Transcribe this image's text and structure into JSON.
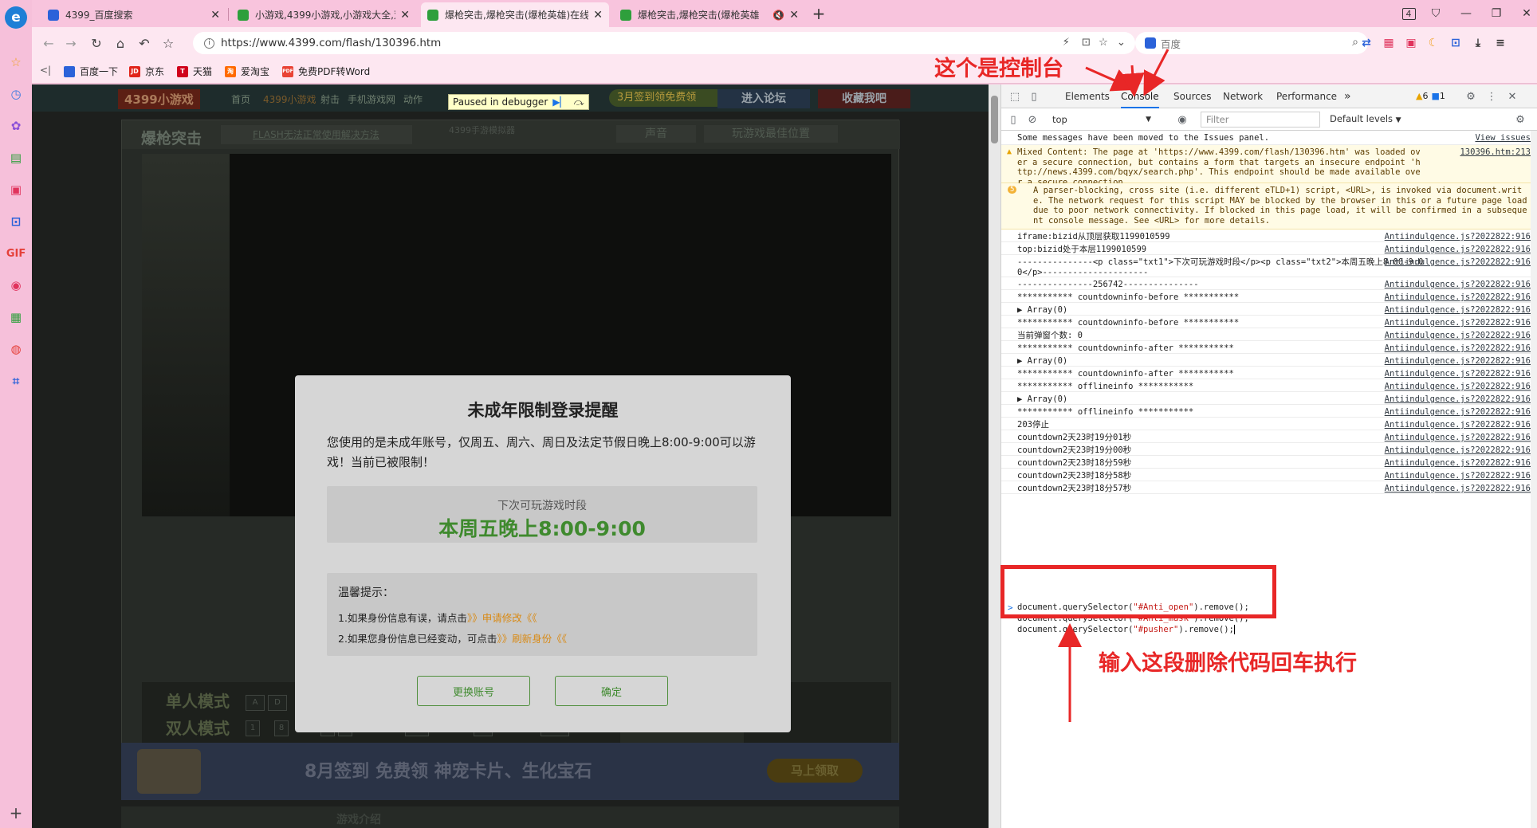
{
  "sidebar": {
    "icons": [
      "browser-logo-icon",
      "star-icon",
      "clock-icon",
      "puzzle-icon",
      "notes-icon",
      "pdf-icon",
      "crop-icon",
      "gif-icon",
      "record-icon",
      "qr-icon",
      "weibo-icon",
      "scan-icon",
      "add-icon"
    ],
    "gif_label": "GIF",
    "add_label": "+"
  },
  "tabs": [
    {
      "title": "4399_百度搜索",
      "favicon_color": "#2b62d9"
    },
    {
      "title": "小游戏,4399小游戏,小游戏大全,双",
      "favicon_color": "#2e9f3c"
    },
    {
      "title": "爆枪突击,爆枪突击(爆枪英雄)在线",
      "favicon_color": "#2e9f3c",
      "active": true
    },
    {
      "title": "爆枪突击,爆枪突击(爆枪英雄",
      "favicon_color": "#2e9f3c",
      "muted": true
    }
  ],
  "tab_new": "+",
  "tab_close": "✕",
  "window": {
    "tab_count": "4"
  },
  "address": {
    "url": "https://www.4399.com/flash/130396.htm",
    "search_placeholder": "百度"
  },
  "bookmarks": [
    {
      "label": "百度一下",
      "color": "#2b62d9",
      "glyph": "🐾"
    },
    {
      "label": "京东",
      "color": "#e1251b",
      "glyph": "JD"
    },
    {
      "label": "天猫",
      "color": "#d0021b",
      "glyph": "T"
    },
    {
      "label": "爱淘宝",
      "color": "#ff6a00",
      "glyph": "淘"
    },
    {
      "label": "免费PDF转Word",
      "color": "#e94335",
      "glyph": "PDF"
    }
  ],
  "page": {
    "logo": "4399小游戏",
    "nav": [
      "首页",
      "4399小游戏",
      "射击",
      "手机游戏网",
      "动作"
    ],
    "debugger_tip": "Paused in debugger",
    "checkin": "3月签到领免费领",
    "forum_btn": "进入论坛",
    "fav_btn": "收藏我吧",
    "game_title": "爆枪突击",
    "flash_tip": "FLASH无法正常使用解决方法",
    "promo_small": "4399手游模拟器",
    "sound": "声音",
    "best_pos": "玩游戏最佳位置",
    "mode_single": "单人模式",
    "mode_double": "双人模式",
    "banner_text": "8月签到 免费领 神宠卡片、生化宝石",
    "banner_btn": "马上领取",
    "intro": "游戏介绍"
  },
  "modal": {
    "title": "未成年限制登录提醒",
    "body": "您使用的是未成年账号，仅周五、周六、周日及法定节假日晚上8:00-9:00可以游戏！当前已被限制！",
    "next_label": "下次可玩游戏时段",
    "next_time": "本周五晚上8:00-9:00",
    "tips_title": "温馨提示：",
    "tip1_prefix": "1.如果身份信息有误，请点击",
    "tip1_link": "》》申请修改《《",
    "tip2_prefix": "2.如果您身份信息已经变动，可点击",
    "tip2_link": "》》刷新身份《《",
    "btn_switch": "更换账号",
    "btn_ok": "确定"
  },
  "devtools": {
    "tabs": [
      "Elements",
      "Console",
      "Sources",
      "Network",
      "Performance"
    ],
    "active_tab": "Console",
    "more": "»",
    "warn_count": "6",
    "issue_count": "1",
    "context": "top",
    "filter_placeholder": "Filter",
    "levels": "Default levels",
    "rows": [
      {
        "type": "info",
        "msg": "Some messages have been moved to the Issues panel.",
        "src": "View issues"
      },
      {
        "type": "warn",
        "msg": "Mixed Content: The page at 'https://www.4399.com/flash/130396.htm' was loaded over a secure connection, but contains a form that targets an insecure endpoint 'http://news.4399.com/bqyx/search.php'. This endpoint should be made available over a secure connection.",
        "src": "130396.htm:213"
      },
      {
        "type": "warn5",
        "msg": "A parser-blocking, cross site (i.e. different eTLD+1) script, <URL>, is invoked via document.write. The network request for this script MAY be blocked by the browser in this or a future page load due to poor network connectivity. If blocked in this page load, it will be confirmed in a subsequent console message. See <URL> for more details.",
        "src": "",
        "badge": "5"
      },
      {
        "type": "log",
        "msg": "iframe:bizid从顶层获取1199010599",
        "src": "Antiindulgence.js?2022822:916"
      },
      {
        "type": "log",
        "msg": "top:bizid处于本层1199010599",
        "src": "Antiindulgence.js?2022822:916"
      },
      {
        "type": "log",
        "msg": "---------------<p class=\"txt1\">下次可玩游戏时段</p><p class=\"txt2\">本周五晚上8:00-9:00</p>---------------------",
        "src": "Antiindulgence.js?2022822:916"
      },
      {
        "type": "log",
        "msg": "---------------256742---------------",
        "src": "Antiindulgence.js?2022822:916"
      },
      {
        "type": "log",
        "msg": "*********** countdowninfo-before ***********",
        "src": "Antiindulgence.js?2022822:916"
      },
      {
        "type": "log",
        "msg": "▶ Array(0)",
        "src": "Antiindulgence.js?2022822:916"
      },
      {
        "type": "log",
        "msg": "*********** countdowninfo-before ***********",
        "src": "Antiindulgence.js?2022822:916"
      },
      {
        "type": "log",
        "msg": "当前弹窗个数: 0",
        "src": "Antiindulgence.js?2022822:916"
      },
      {
        "type": "log",
        "msg": "*********** countdowninfo-after ***********",
        "src": "Antiindulgence.js?2022822:916"
      },
      {
        "type": "log",
        "msg": "▶ Array(0)",
        "src": "Antiindulgence.js?2022822:916"
      },
      {
        "type": "log",
        "msg": "*********** countdowninfo-after ***********",
        "src": "Antiindulgence.js?2022822:916"
      },
      {
        "type": "log",
        "msg": "*********** offlineinfo ***********",
        "src": "Antiindulgence.js?2022822:916"
      },
      {
        "type": "log",
        "msg": "▶ Array(0)",
        "src": "Antiindulgence.js?2022822:916"
      },
      {
        "type": "log",
        "msg": "*********** offlineinfo ***********",
        "src": "Antiindulgence.js?2022822:916"
      },
      {
        "type": "log",
        "msg": "203停止",
        "src": "Antiindulgence.js?2022822:916"
      },
      {
        "type": "log",
        "msg": "countdown2天23时19分01秒",
        "src": "Antiindulgence.js?2022822:916"
      },
      {
        "type": "log",
        "msg": "countdown2天23时19分00秒",
        "src": "Antiindulgence.js?2022822:916"
      },
      {
        "type": "log",
        "msg": "countdown2天23时18分59秒",
        "src": "Antiindulgence.js?2022822:916"
      },
      {
        "type": "log",
        "msg": "countdown2天23时18分58秒",
        "src": "Antiindulgence.js?2022822:916"
      },
      {
        "type": "log",
        "msg": "countdown2天23时18分57秒",
        "src": "Antiindulgence.js?2022822:916"
      }
    ],
    "input_prompt": ">",
    "code": [
      {
        "pre": "document.querySelector(",
        "str": "\"#Anti_open\"",
        "post": ").remove();"
      },
      {
        "pre": "document.querySelector(",
        "str": "\"#Anti_mask\"",
        "post": ").remove();"
      },
      {
        "pre": "document.querySelector(",
        "str": "\"#pusher\"",
        "post": ").remove();"
      }
    ]
  },
  "annotations": {
    "top": "这个是控制台",
    "bottom": "输入这段删除代码回车执行",
    "color": "#e82727"
  }
}
